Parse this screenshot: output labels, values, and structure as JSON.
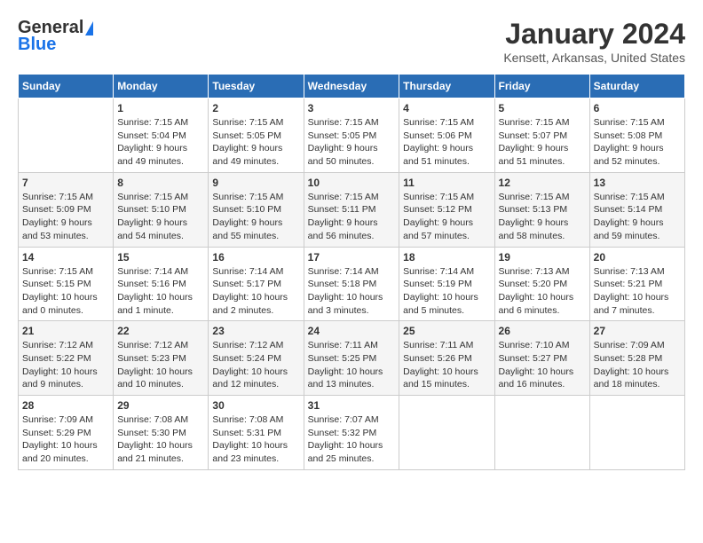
{
  "header": {
    "logo_general": "General",
    "logo_blue": "Blue",
    "title": "January 2024",
    "location": "Kensett, Arkansas, United States"
  },
  "weekdays": [
    "Sunday",
    "Monday",
    "Tuesday",
    "Wednesday",
    "Thursday",
    "Friday",
    "Saturday"
  ],
  "weeks": [
    [
      {
        "day": "",
        "info": ""
      },
      {
        "day": "1",
        "info": "Sunrise: 7:15 AM\nSunset: 5:04 PM\nDaylight: 9 hours\nand 49 minutes."
      },
      {
        "day": "2",
        "info": "Sunrise: 7:15 AM\nSunset: 5:05 PM\nDaylight: 9 hours\nand 49 minutes."
      },
      {
        "day": "3",
        "info": "Sunrise: 7:15 AM\nSunset: 5:05 PM\nDaylight: 9 hours\nand 50 minutes."
      },
      {
        "day": "4",
        "info": "Sunrise: 7:15 AM\nSunset: 5:06 PM\nDaylight: 9 hours\nand 51 minutes."
      },
      {
        "day": "5",
        "info": "Sunrise: 7:15 AM\nSunset: 5:07 PM\nDaylight: 9 hours\nand 51 minutes."
      },
      {
        "day": "6",
        "info": "Sunrise: 7:15 AM\nSunset: 5:08 PM\nDaylight: 9 hours\nand 52 minutes."
      }
    ],
    [
      {
        "day": "7",
        "info": "Sunrise: 7:15 AM\nSunset: 5:09 PM\nDaylight: 9 hours\nand 53 minutes."
      },
      {
        "day": "8",
        "info": "Sunrise: 7:15 AM\nSunset: 5:10 PM\nDaylight: 9 hours\nand 54 minutes."
      },
      {
        "day": "9",
        "info": "Sunrise: 7:15 AM\nSunset: 5:10 PM\nDaylight: 9 hours\nand 55 minutes."
      },
      {
        "day": "10",
        "info": "Sunrise: 7:15 AM\nSunset: 5:11 PM\nDaylight: 9 hours\nand 56 minutes."
      },
      {
        "day": "11",
        "info": "Sunrise: 7:15 AM\nSunset: 5:12 PM\nDaylight: 9 hours\nand 57 minutes."
      },
      {
        "day": "12",
        "info": "Sunrise: 7:15 AM\nSunset: 5:13 PM\nDaylight: 9 hours\nand 58 minutes."
      },
      {
        "day": "13",
        "info": "Sunrise: 7:15 AM\nSunset: 5:14 PM\nDaylight: 9 hours\nand 59 minutes."
      }
    ],
    [
      {
        "day": "14",
        "info": "Sunrise: 7:15 AM\nSunset: 5:15 PM\nDaylight: 10 hours\nand 0 minutes."
      },
      {
        "day": "15",
        "info": "Sunrise: 7:14 AM\nSunset: 5:16 PM\nDaylight: 10 hours\nand 1 minute."
      },
      {
        "day": "16",
        "info": "Sunrise: 7:14 AM\nSunset: 5:17 PM\nDaylight: 10 hours\nand 2 minutes."
      },
      {
        "day": "17",
        "info": "Sunrise: 7:14 AM\nSunset: 5:18 PM\nDaylight: 10 hours\nand 3 minutes."
      },
      {
        "day": "18",
        "info": "Sunrise: 7:14 AM\nSunset: 5:19 PM\nDaylight: 10 hours\nand 5 minutes."
      },
      {
        "day": "19",
        "info": "Sunrise: 7:13 AM\nSunset: 5:20 PM\nDaylight: 10 hours\nand 6 minutes."
      },
      {
        "day": "20",
        "info": "Sunrise: 7:13 AM\nSunset: 5:21 PM\nDaylight: 10 hours\nand 7 minutes."
      }
    ],
    [
      {
        "day": "21",
        "info": "Sunrise: 7:12 AM\nSunset: 5:22 PM\nDaylight: 10 hours\nand 9 minutes."
      },
      {
        "day": "22",
        "info": "Sunrise: 7:12 AM\nSunset: 5:23 PM\nDaylight: 10 hours\nand 10 minutes."
      },
      {
        "day": "23",
        "info": "Sunrise: 7:12 AM\nSunset: 5:24 PM\nDaylight: 10 hours\nand 12 minutes."
      },
      {
        "day": "24",
        "info": "Sunrise: 7:11 AM\nSunset: 5:25 PM\nDaylight: 10 hours\nand 13 minutes."
      },
      {
        "day": "25",
        "info": "Sunrise: 7:11 AM\nSunset: 5:26 PM\nDaylight: 10 hours\nand 15 minutes."
      },
      {
        "day": "26",
        "info": "Sunrise: 7:10 AM\nSunset: 5:27 PM\nDaylight: 10 hours\nand 16 minutes."
      },
      {
        "day": "27",
        "info": "Sunrise: 7:09 AM\nSunset: 5:28 PM\nDaylight: 10 hours\nand 18 minutes."
      }
    ],
    [
      {
        "day": "28",
        "info": "Sunrise: 7:09 AM\nSunset: 5:29 PM\nDaylight: 10 hours\nand 20 minutes."
      },
      {
        "day": "29",
        "info": "Sunrise: 7:08 AM\nSunset: 5:30 PM\nDaylight: 10 hours\nand 21 minutes."
      },
      {
        "day": "30",
        "info": "Sunrise: 7:08 AM\nSunset: 5:31 PM\nDaylight: 10 hours\nand 23 minutes."
      },
      {
        "day": "31",
        "info": "Sunrise: 7:07 AM\nSunset: 5:32 PM\nDaylight: 10 hours\nand 25 minutes."
      },
      {
        "day": "",
        "info": ""
      },
      {
        "day": "",
        "info": ""
      },
      {
        "day": "",
        "info": ""
      }
    ]
  ]
}
